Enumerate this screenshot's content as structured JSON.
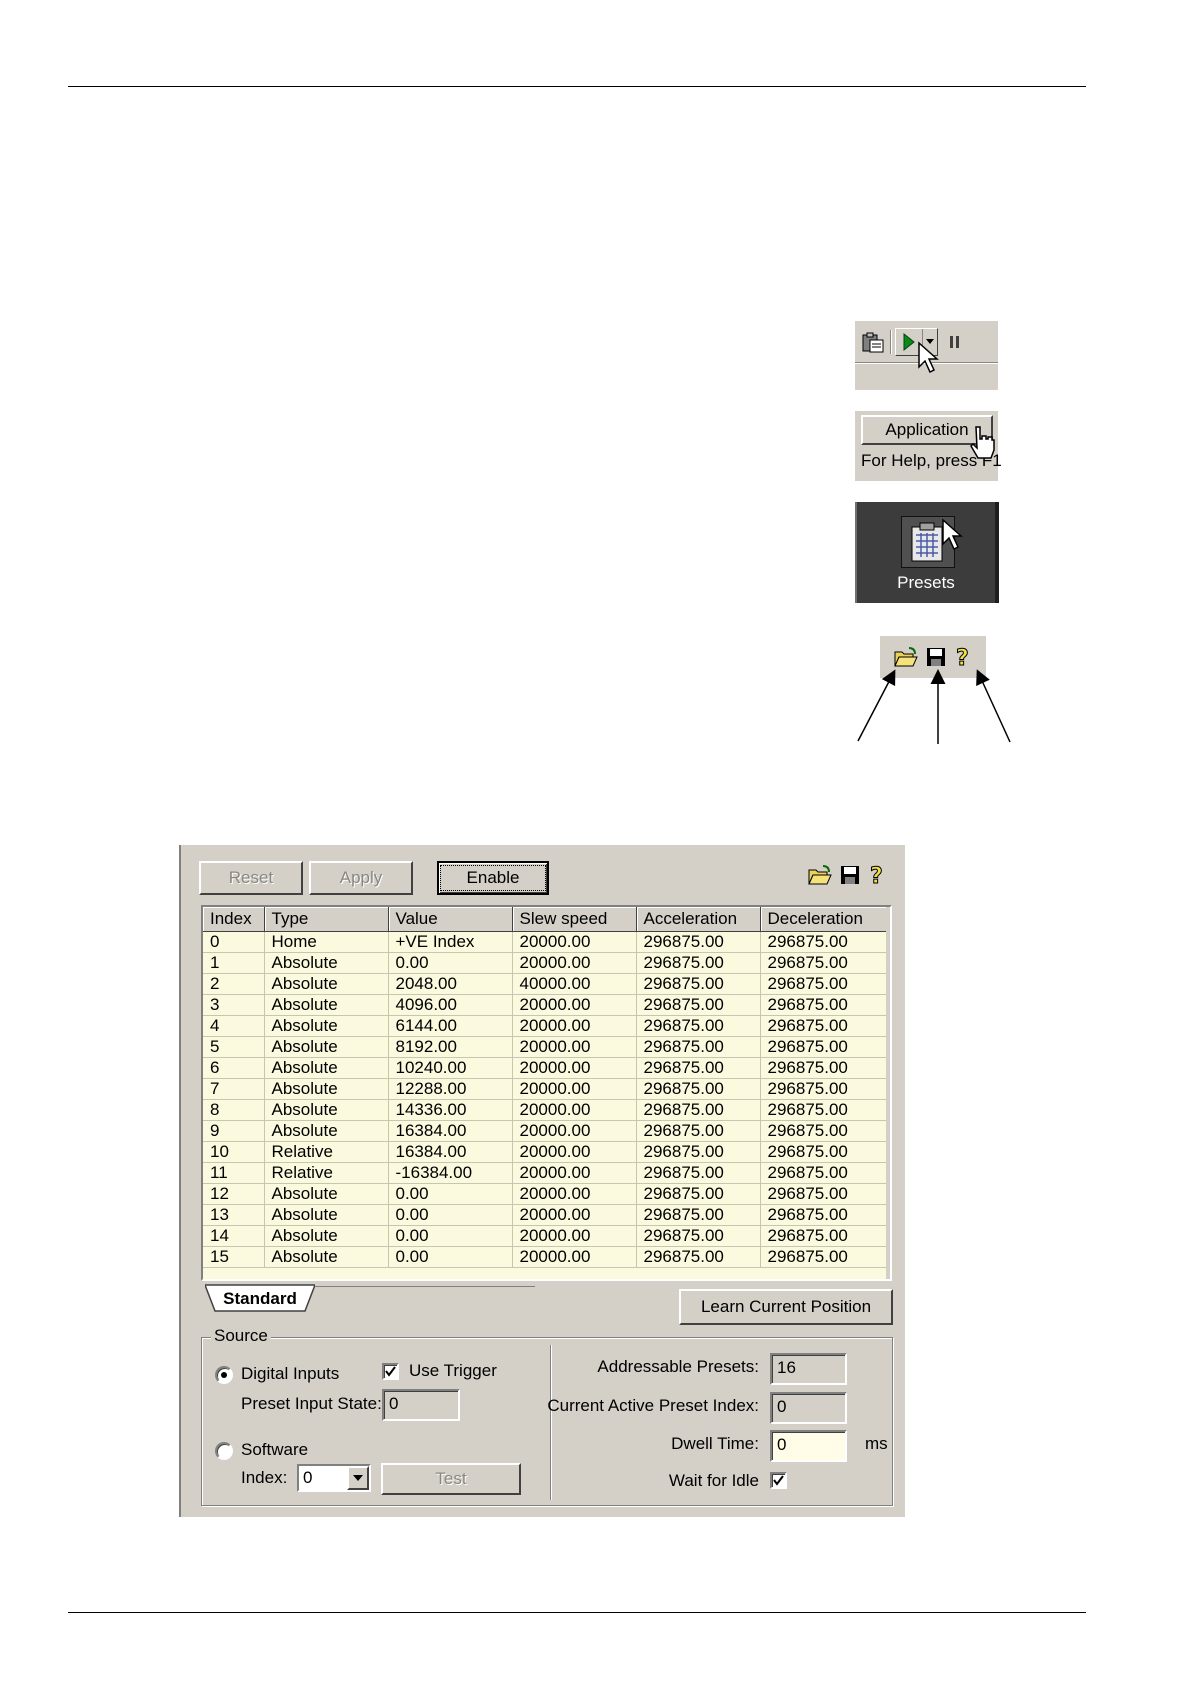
{
  "snippets": {
    "toolbar": {
      "icons": [
        "clipboard-icon",
        "play-icon",
        "dropdown-arrow-icon",
        "pause-icon"
      ]
    },
    "status_bar": {
      "application_label": "Application",
      "help_text": "For Help, press F1"
    },
    "presets_launcher": {
      "label": "Presets"
    },
    "file_icons": [
      "open-folder-icon",
      "save-disk-icon",
      "help-icon"
    ]
  },
  "dialog": {
    "buttons": {
      "reset": "Reset",
      "apply": "Apply",
      "enable": "Enable",
      "learn": "Learn Current Position",
      "test": "Test"
    },
    "table": {
      "columns": [
        "Index",
        "Type",
        "Value",
        "Slew speed",
        "Acceleration",
        "Deceleration"
      ],
      "rows": [
        [
          "0",
          "Home",
          "+VE Index",
          "20000.00",
          "296875.00",
          "296875.00"
        ],
        [
          "1",
          "Absolute",
          "0.00",
          "20000.00",
          "296875.00",
          "296875.00"
        ],
        [
          "2",
          "Absolute",
          "2048.00",
          "40000.00",
          "296875.00",
          "296875.00"
        ],
        [
          "3",
          "Absolute",
          "4096.00",
          "20000.00",
          "296875.00",
          "296875.00"
        ],
        [
          "4",
          "Absolute",
          "6144.00",
          "20000.00",
          "296875.00",
          "296875.00"
        ],
        [
          "5",
          "Absolute",
          "8192.00",
          "20000.00",
          "296875.00",
          "296875.00"
        ],
        [
          "6",
          "Absolute",
          "10240.00",
          "20000.00",
          "296875.00",
          "296875.00"
        ],
        [
          "7",
          "Absolute",
          "12288.00",
          "20000.00",
          "296875.00",
          "296875.00"
        ],
        [
          "8",
          "Absolute",
          "14336.00",
          "20000.00",
          "296875.00",
          "296875.00"
        ],
        [
          "9",
          "Absolute",
          "16384.00",
          "20000.00",
          "296875.00",
          "296875.00"
        ],
        [
          "10",
          "Relative",
          "16384.00",
          "20000.00",
          "296875.00",
          "296875.00"
        ],
        [
          "11",
          "Relative",
          "-16384.00",
          "20000.00",
          "296875.00",
          "296875.00"
        ],
        [
          "12",
          "Absolute",
          "0.00",
          "20000.00",
          "296875.00",
          "296875.00"
        ],
        [
          "13",
          "Absolute",
          "0.00",
          "20000.00",
          "296875.00",
          "296875.00"
        ],
        [
          "14",
          "Absolute",
          "0.00",
          "20000.00",
          "296875.00",
          "296875.00"
        ],
        [
          "15",
          "Absolute",
          "0.00",
          "20000.00",
          "296875.00",
          "296875.00"
        ]
      ]
    },
    "tab": "Standard",
    "source": {
      "title": "Source",
      "digital_inputs": "Digital Inputs",
      "use_trigger": "Use Trigger",
      "preset_input_state_label": "Preset Input State:",
      "preset_input_state_value": "0",
      "software": "Software",
      "index_label": "Index:",
      "index_value": "0"
    },
    "info": {
      "addressable_presets_label": "Addressable Presets:",
      "addressable_presets_value": "16",
      "current_active_label": "Current Active Preset Index:",
      "current_active_value": "0",
      "dwell_time_label": "Dwell Time:",
      "dwell_time_value": "0",
      "dwell_unit": "ms",
      "wait_for_idle_label": "Wait for Idle"
    },
    "state": {
      "digital_inputs_selected": true,
      "use_trigger_checked": true,
      "wait_for_idle_checked": true
    }
  }
}
